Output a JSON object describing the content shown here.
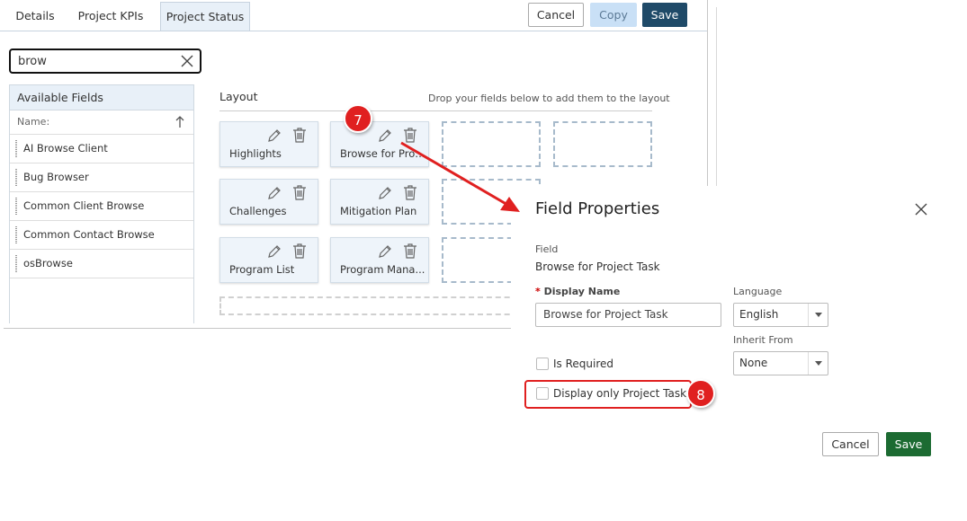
{
  "tabs": [
    {
      "label": "Details",
      "active": false
    },
    {
      "label": "Project KPIs",
      "active": false
    },
    {
      "label": "Project Status",
      "active": true
    }
  ],
  "toolbar": {
    "cancel_label": "Cancel",
    "copy_label": "Copy",
    "save_label": "Save"
  },
  "search": {
    "value": "brow"
  },
  "available_fields": {
    "title": "Available Fields",
    "column_header": "Name:",
    "items": [
      "AI Browse Client",
      "Bug Browser",
      "Common Client Browse",
      "Common Contact Browse",
      "osBrowse"
    ]
  },
  "layout": {
    "title": "Layout",
    "hint": "Drop your fields below to add them to the layout",
    "cards": [
      "Highlights",
      "Browse for Proj...",
      "Challenges",
      "Mitigation Plan",
      "Program List",
      "Program Mana..."
    ]
  },
  "annotations": {
    "step7": "7",
    "step8": "8"
  },
  "dialog": {
    "title": "Field Properties",
    "field_label": "Field",
    "field_value": "Browse for Project Task",
    "display_name_required": "*",
    "display_name_label": "Display Name",
    "display_name_value": "Browse for Project Task",
    "language_label": "Language",
    "language_value": "English",
    "inherit_label": "Inherit From",
    "inherit_value": "None",
    "is_required_label": "Is Required",
    "display_only_label": "Display only Project Tasks",
    "cancel_label": "Cancel",
    "save_label": "Save"
  },
  "colors": {
    "accent_navy": "#1f4a68",
    "save_green": "#1c6b32",
    "annotation_red": "#e02020",
    "copy_disabled": "#c9e0f6"
  }
}
